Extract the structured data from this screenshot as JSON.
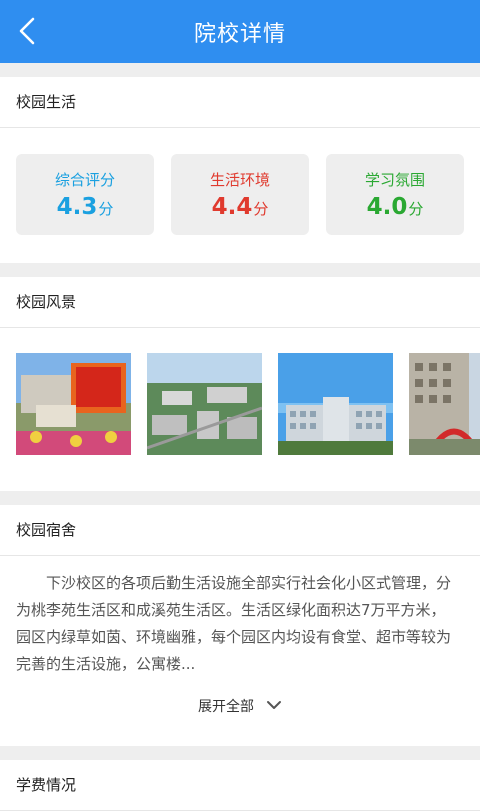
{
  "header": {
    "title": "院校详情"
  },
  "campus_life": {
    "heading": "校园生活",
    "scores": [
      {
        "label": "综合评分",
        "value": "4.3",
        "unit": "分",
        "color": "#1aa0e0"
      },
      {
        "label": "生活环境",
        "value": "4.4",
        "unit": "分",
        "color": "#e03a2e"
      },
      {
        "label": "学习氛围",
        "value": "4.0",
        "unit": "分",
        "color": "#2aa832"
      }
    ]
  },
  "scenery": {
    "heading": "校园风景"
  },
  "dorm": {
    "heading": "校园宿舍",
    "text": "下沙校区的各项后勤生活设施全部实行社会化小区式管理，分为桃李苑生活区和成溪苑生活区。生活区绿化面积达7万平方米，园区内绿草如茵、环境幽雅，每个园区内均设有食堂、超市等较为完善的生活设施，公寓楼...",
    "expand_label": "展开全部"
  },
  "tuition": {
    "heading": "学费情况"
  }
}
